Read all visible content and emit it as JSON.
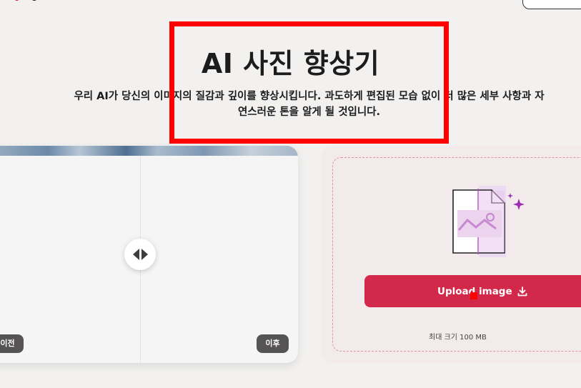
{
  "hero": {
    "title": "AI 사진 향상기",
    "description": "우리 AI가 당신의 이미지의 질감과 깊이를 향상시킵니다. 과도하게 편집된 모습 없이 더 많은 세부 사항과 자연스러운 톤을 알게 될 것입니다."
  },
  "compare": {
    "before_label": "이전",
    "after_label": "이후"
  },
  "upload": {
    "button_label": "Upload image",
    "max_size": "최대 크기 100 MB"
  },
  "colors": {
    "accent": "#d2294a",
    "highlight": "#ff0000",
    "pill": "#555353",
    "upload_panel": "#f3ebeb",
    "background": "#f2f1f0"
  },
  "icons": [
    "upload-download-icon",
    "image-file-icon",
    "sparkle-icon",
    "compare-arrows-icon"
  ]
}
